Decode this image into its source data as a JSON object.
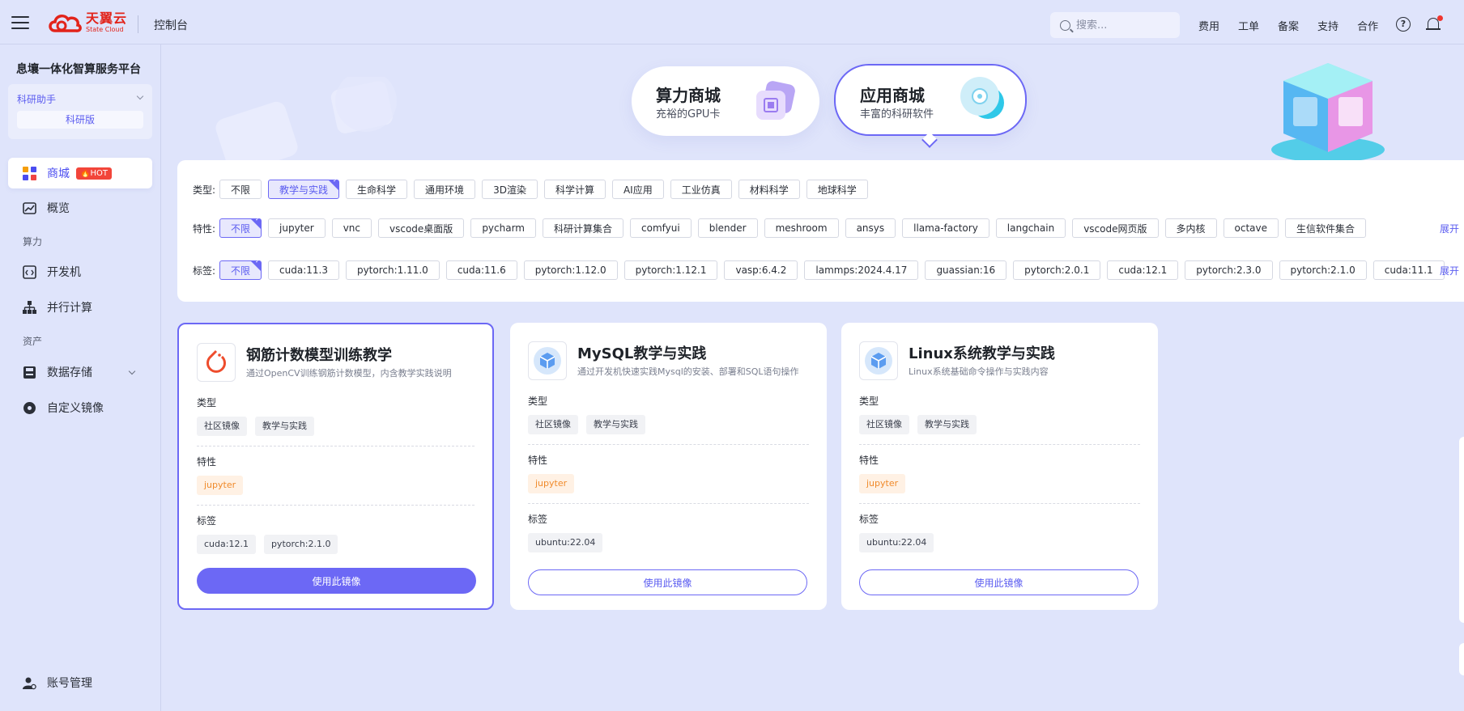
{
  "header": {
    "logo_cn": "天翼云",
    "logo_en": "State Cloud",
    "console_label": "控制台",
    "search_placeholder": "搜索...",
    "nav": [
      "费用",
      "工单",
      "备案",
      "支持",
      "合作"
    ],
    "help_icon": "question-circle-icon",
    "bell_icon": "bell-icon"
  },
  "sidebar": {
    "platform_title": "息壤一体化智算服务平台",
    "assistant_label": "科研助手",
    "edition_label": "科研版",
    "items": [
      {
        "label": "商城",
        "badge": "HOT",
        "icon": "grid-apps-icon",
        "active": true
      },
      {
        "label": "概览",
        "icon": "trend-chart-icon"
      },
      {
        "label": "开发机",
        "icon": "code-window-icon"
      },
      {
        "label": "并行计算",
        "icon": "hierarchy-icon"
      },
      {
        "label": "数据存储",
        "icon": "disk-icon"
      },
      {
        "label": "自定义镜像",
        "icon": "disc-icon"
      },
      {
        "label": "账号管理",
        "icon": "user-gear-icon"
      }
    ],
    "groups": {
      "compute": "算力",
      "assets": "资产"
    }
  },
  "hero": {
    "stores": [
      {
        "title": "算力商城",
        "subtitle": "充裕的GPU卡",
        "icon": "chip-icon"
      },
      {
        "title": "应用商城",
        "subtitle": "丰富的科研软件",
        "icon": "disc-app-icon",
        "selected": true
      }
    ]
  },
  "filters": {
    "type": {
      "label": "类型:",
      "options": [
        "不限",
        "教学与实践",
        "生命科学",
        "通用环境",
        "3D渲染",
        "科学计算",
        "AI应用",
        "工业仿真",
        "材料科学",
        "地球科学"
      ],
      "selected": "教学与实践"
    },
    "feature": {
      "label": "特性:",
      "options": [
        "不限",
        "jupyter",
        "vnc",
        "vscode桌面版",
        "pycharm",
        "科研计算集合",
        "comfyui",
        "blender",
        "meshroom",
        "ansys",
        "llama-factory",
        "langchain",
        "vscode网页版",
        "多内核",
        "octave",
        "生信软件集合"
      ],
      "selected": "不限",
      "expand": "展开"
    },
    "tag": {
      "label": "标签:",
      "options": [
        "不限",
        "cuda:11.3",
        "pytorch:1.11.0",
        "cuda:11.6",
        "pytorch:1.12.0",
        "pytorch:1.12.1",
        "vasp:6.4.2",
        "lammps:2024.4.17",
        "guassian:16",
        "pytorch:2.0.1",
        "cuda:12.1",
        "pytorch:2.3.0",
        "pytorch:2.1.0",
        "cuda:11.1"
      ],
      "selected": "不限",
      "expand": "展开"
    }
  },
  "cards": [
    {
      "title": "钢筋计数模型训练教学",
      "description": "通过OpenCV训练钢筋计数模型，内含教学实践说明",
      "icon": "pytorch-flame-icon",
      "type_label": "类型",
      "types": [
        "社区镜像",
        "教学与实践"
      ],
      "feature_label": "特性",
      "features": [
        "jupyter"
      ],
      "tag_label": "标签",
      "tags": [
        "cuda:12.1",
        "pytorch:2.1.0"
      ],
      "button": "使用此镜像",
      "highlighted": true
    },
    {
      "title": "MySQL教学与实践",
      "description": "通过开发机快速实践Mysql的安装、部署和SQL语句操作",
      "icon": "package-cube-icon",
      "type_label": "类型",
      "types": [
        "社区镜像",
        "教学与实践"
      ],
      "feature_label": "特性",
      "features": [
        "jupyter"
      ],
      "tag_label": "标签",
      "tags": [
        "ubuntu:22.04"
      ],
      "button": "使用此镜像"
    },
    {
      "title": "Linux系统教学与实践",
      "description": "Linux系统基础命令操作与实践内容",
      "icon": "package-cube-icon",
      "type_label": "类型",
      "types": [
        "社区镜像",
        "教学与实践"
      ],
      "feature_label": "特性",
      "features": [
        "jupyter"
      ],
      "tag_label": "标签",
      "tags": [
        "ubuntu:22.04"
      ],
      "button": "使用此镜像"
    }
  ],
  "colors": {
    "accent": "#6c68f5",
    "background": "#dfe4fb",
    "hot": "#f2453a",
    "brand_red": "#e2231a"
  }
}
